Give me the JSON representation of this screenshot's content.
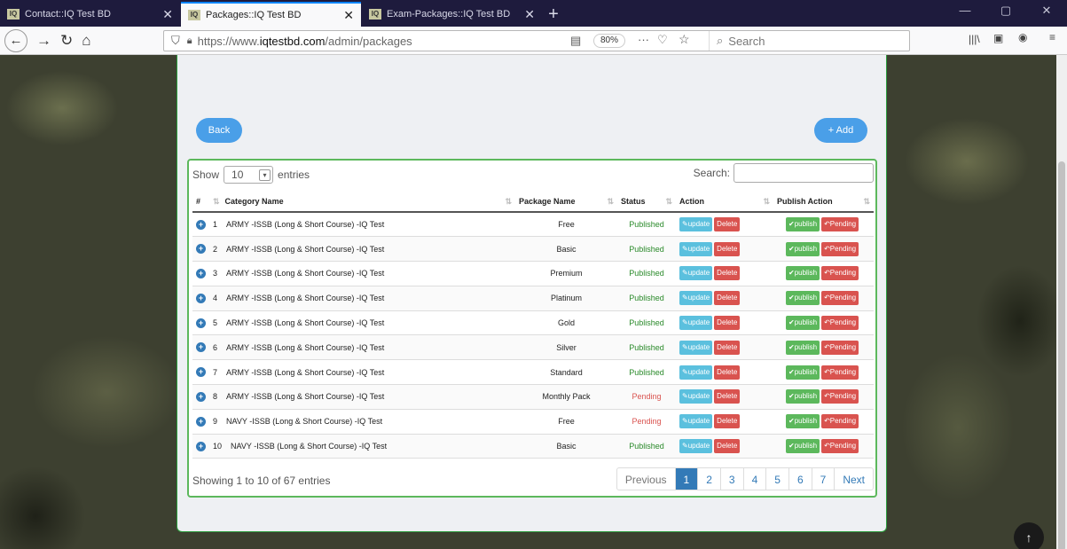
{
  "browser": {
    "tabs": [
      {
        "label": "Contact::IQ Test BD",
        "favicon": "iq-logo",
        "active": false
      },
      {
        "label": "Packages::IQ Test BD",
        "favicon": "iq-logo",
        "active": true
      },
      {
        "label": "Exam-Packages::IQ Test BD",
        "favicon": "iq-logo",
        "active": false
      }
    ],
    "favicon_text": "IQ",
    "url_prefix": "https://www.",
    "url_domain": "iqtestbd.com",
    "url_path": "/admin/packages",
    "zoom": "80%",
    "search_placeholder": "Search"
  },
  "page": {
    "back_label": "Back",
    "add_label": "+ Add",
    "show_label": "Show",
    "entries_value": "10",
    "entries_label": "entries",
    "search_label": "Search:",
    "columns": [
      "#",
      "Category Name",
      "Package Name",
      "Status",
      "Action",
      "Publish Action"
    ],
    "action_update": "update",
    "action_delete": "Delete",
    "action_publish": "publish",
    "action_pending": "Pending",
    "rows": [
      {
        "num": "1",
        "category": "ARMY -ISSB (Long & Short Course) -IQ Test",
        "package": "Free",
        "status": "Published"
      },
      {
        "num": "2",
        "category": "ARMY -ISSB (Long & Short Course) -IQ Test",
        "package": "Basic",
        "status": "Published"
      },
      {
        "num": "3",
        "category": "ARMY -ISSB (Long & Short Course) -IQ Test",
        "package": "Premium",
        "status": "Published"
      },
      {
        "num": "4",
        "category": "ARMY -ISSB (Long & Short Course) -IQ Test",
        "package": "Platinum",
        "status": "Published"
      },
      {
        "num": "5",
        "category": "ARMY -ISSB (Long & Short Course) -IQ Test",
        "package": "Gold",
        "status": "Published"
      },
      {
        "num": "6",
        "category": "ARMY -ISSB (Long & Short Course) -IQ Test",
        "package": "Silver",
        "status": "Published"
      },
      {
        "num": "7",
        "category": "ARMY -ISSB (Long & Short Course) -IQ Test",
        "package": "Standard",
        "status": "Published"
      },
      {
        "num": "8",
        "category": "ARMY -ISSB (Long & Short Course) -IQ Test",
        "package": "Monthly Pack",
        "status": "Pending"
      },
      {
        "num": "9",
        "category": "NAVY -ISSB (Long & Short Course) -IQ Test",
        "package": "Free",
        "status": "Pending"
      },
      {
        "num": "10",
        "category": "NAVY -ISSB (Long & Short Course) -IQ Test",
        "package": "Basic",
        "status": "Published"
      }
    ],
    "footer_info": "Showing 1 to 10 of 67 entries",
    "pagination": [
      "Previous",
      "1",
      "2",
      "3",
      "4",
      "5",
      "6",
      "7",
      "Next"
    ],
    "current_page": "1"
  },
  "colors": {
    "accent": "#4a9fe8",
    "published": "#2a8a2a",
    "pending": "#d9534f",
    "table_border": "#5cb85c"
  }
}
